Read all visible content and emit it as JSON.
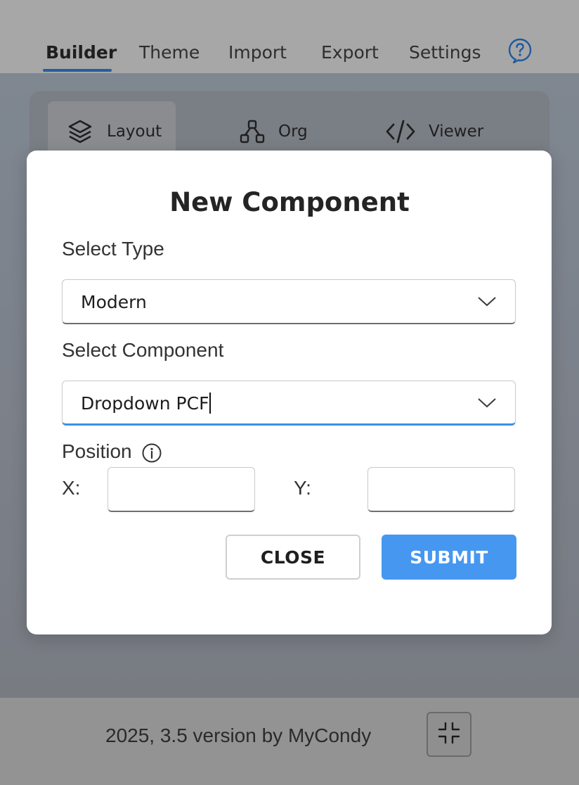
{
  "nav": {
    "tabs": [
      {
        "label": "Builder",
        "active": true
      },
      {
        "label": "Theme"
      },
      {
        "label": "Import"
      },
      {
        "label": "Export"
      },
      {
        "label": "Settings"
      }
    ],
    "help_icon": "question-circle-icon"
  },
  "subnav": {
    "items": [
      {
        "label": "Layout",
        "icon": "layers-icon",
        "active": true
      },
      {
        "label": "Org",
        "icon": "hierarchy-icon"
      },
      {
        "label": "Viewer",
        "icon": "code-icon"
      }
    ]
  },
  "dialog": {
    "title": "New Component",
    "type_label": "Select Type",
    "type_value": "Modern",
    "component_label": "Select Component",
    "component_value": "Dropdown PCF",
    "position_label": "Position",
    "x_label": "X:",
    "y_label": "Y:",
    "x_value": "",
    "y_value": "",
    "close_label": "CLOSE",
    "submit_label": "SUBMIT"
  },
  "footer": {
    "text": "2025, 3.5 version by MyCondy",
    "minimize_icon": "minimize-icon"
  },
  "colors": {
    "accent": "#4697f0",
    "nav_active": "#255f9e",
    "focus": "#3d8fe6"
  }
}
